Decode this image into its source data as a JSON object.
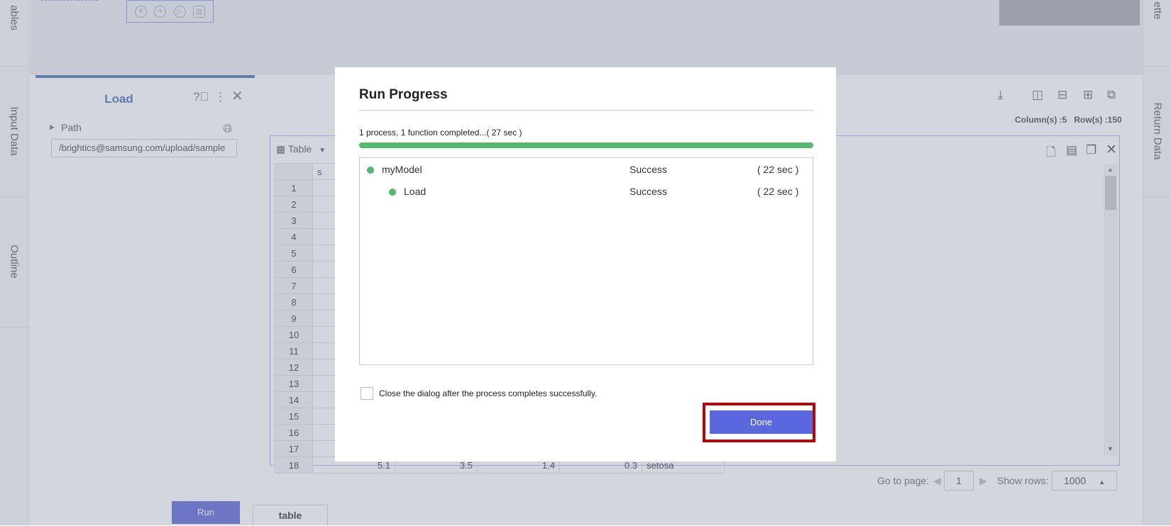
{
  "left_rail": {
    "tabs": [
      "ables",
      "Input Data",
      "Outline"
    ]
  },
  "right_rail": {
    "tabs": [
      "ette",
      "Return Data"
    ]
  },
  "canvas": {
    "node_toolbar_icons": [
      "close-circle-icon",
      "share-icon",
      "play-circle-icon",
      "trash-icon"
    ]
  },
  "load_panel": {
    "title": "Load",
    "path_label": "Path",
    "path_value": "/brightics@samsung.com/upload/sample",
    "run_label": "Run"
  },
  "data_panel": {
    "column_count": "Column(s) :5",
    "row_count": "Row(s) :150",
    "table_tab_label": "Table",
    "partial_header": "s",
    "row_numbers": [
      "1",
      "2",
      "3",
      "4",
      "5",
      "6",
      "7",
      "8",
      "9",
      "10",
      "11",
      "12",
      "13",
      "14",
      "15",
      "16",
      "17",
      "18"
    ],
    "row18_values": [
      "5.1",
      "3.5",
      "1.4",
      "0.3",
      "setosa"
    ],
    "go_to_page_label": "Go to page:",
    "page_value": "1",
    "show_rows_label": "Show rows:",
    "show_rows_value": "1000",
    "bottom_tab_label": "table"
  },
  "dialog": {
    "title": "Run Progress",
    "status_text": "1 process, 1 function completed...( 27 sec )",
    "progress": 1.0,
    "items": [
      {
        "name": "myModel",
        "status": "Success",
        "time": "( 22 sec )"
      },
      {
        "name": "Load",
        "status": "Success",
        "time": "( 22 sec )"
      }
    ],
    "checkbox_label": "Close the dialog after the process completes successfully.",
    "done_label": "Done"
  },
  "colors": {
    "accent": "#5b67df",
    "success": "#55b86f",
    "highlight": "#b3060d",
    "panel_title": "#4a6fb3"
  }
}
